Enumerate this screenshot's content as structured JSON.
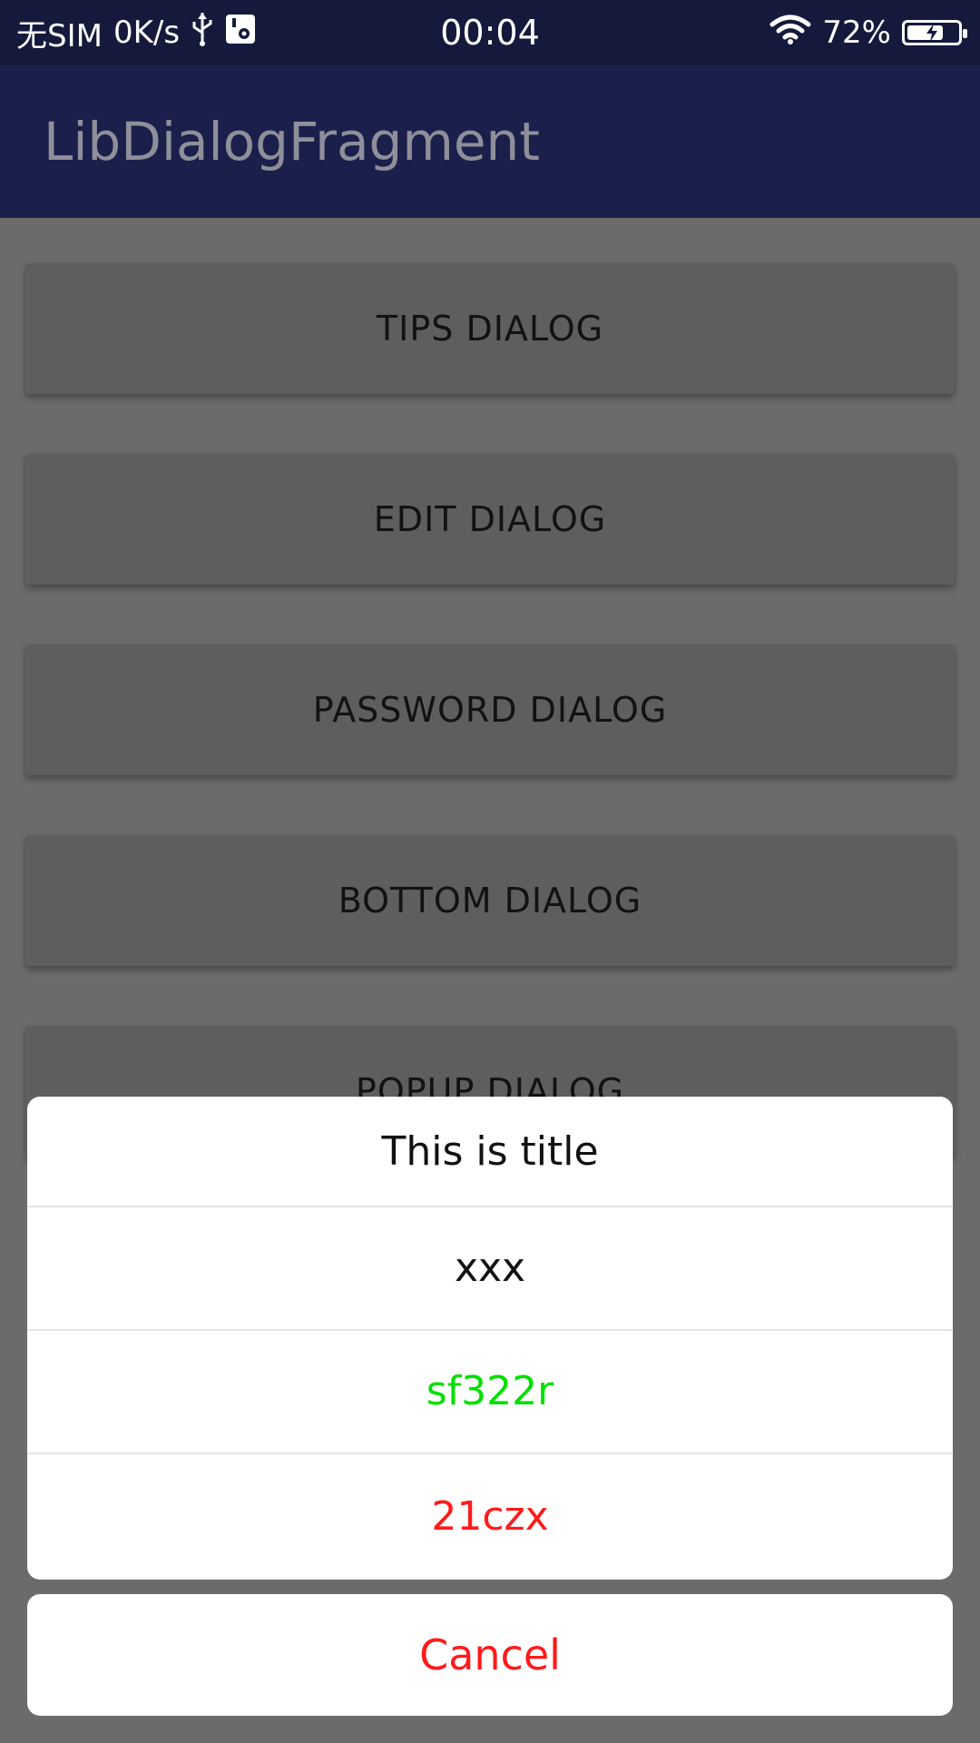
{
  "status_bar": {
    "carrier": "无SIM",
    "speed": "0K/s",
    "time": "00:04",
    "battery_percent_text": "72%",
    "battery_level": 0.72,
    "icons": [
      "usb-icon",
      "settings-icon",
      "wifi-icon",
      "battery-icon"
    ]
  },
  "app_bar": {
    "title": "LibDialogFragment"
  },
  "buttons": [
    {
      "label": "TIPS DIALOG"
    },
    {
      "label": "EDIT DIALOG"
    },
    {
      "label": "PASSWORD DIALOG"
    },
    {
      "label": "BOTTOM DIALOG"
    },
    {
      "label": "POPUP DIALOG"
    }
  ],
  "sheet": {
    "title": "This is title",
    "items": [
      {
        "label": "xxx",
        "color": "#111111"
      },
      {
        "label": "sf322r",
        "color": "#00e000"
      },
      {
        "label": "21czx",
        "color": "#ff1a1a"
      }
    ],
    "cancel_label": "Cancel",
    "cancel_color": "#ff1a1a"
  },
  "colors": {
    "status_bar_bg": "#151a3c",
    "app_bar_bg": "#1a1f4b",
    "scrim_bg": "#6b6b6b",
    "button_bg": "#5e5e5e"
  }
}
